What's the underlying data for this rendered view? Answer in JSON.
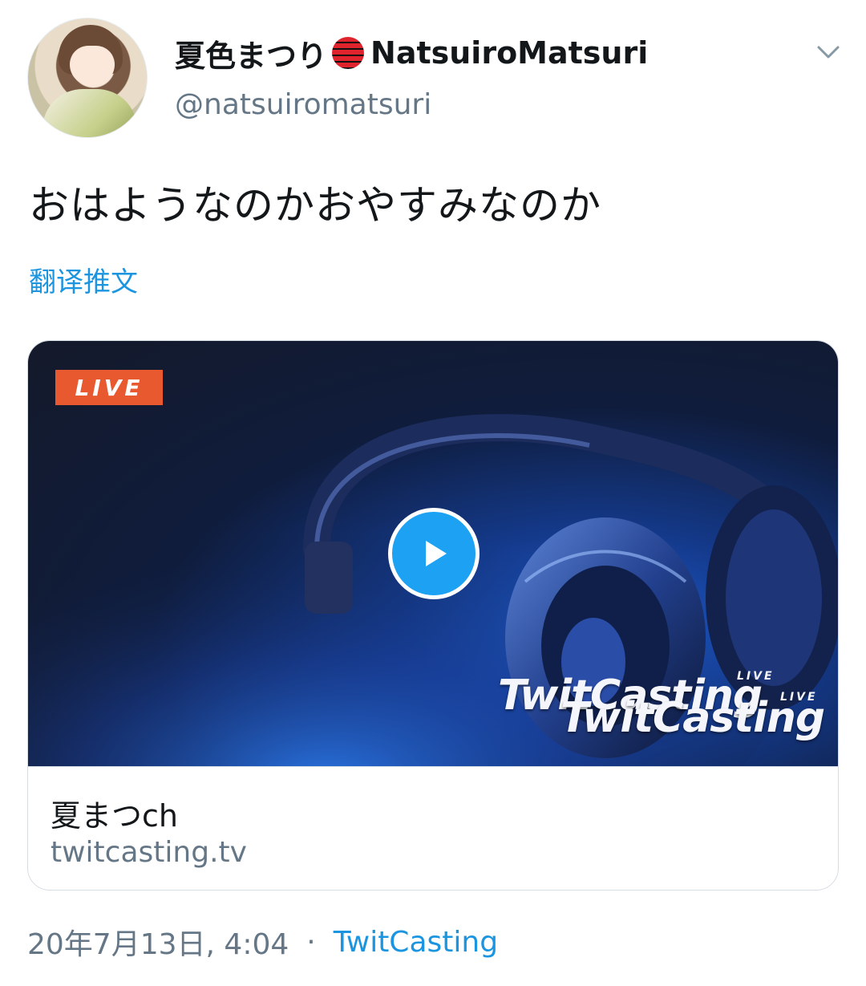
{
  "author": {
    "display_name": "夏色まつり",
    "display_name_latin": "NatsuiroMatsuri",
    "handle": "@natsuiromatsuri"
  },
  "tweet": {
    "text": "おはようなのかおやすみなのか",
    "translate_label": "翻译推文"
  },
  "card": {
    "live_badge": "LIVE",
    "watermark_text": "TwitCasting",
    "watermark_live": "LIVE",
    "title": "夏まつch",
    "domain": "twitcasting.tv"
  },
  "meta": {
    "timestamp": "20年7月13日, 4:04",
    "separator": "·",
    "source": "TwitCasting"
  },
  "icons": {
    "menu": "chevron-down-icon",
    "play": "play-icon",
    "emoji": "red-lantern-icon"
  },
  "colors": {
    "link": "#1b95e0",
    "secondary_text": "#657786",
    "live_badge": "#e8592f",
    "play_button": "#1da1f2"
  }
}
